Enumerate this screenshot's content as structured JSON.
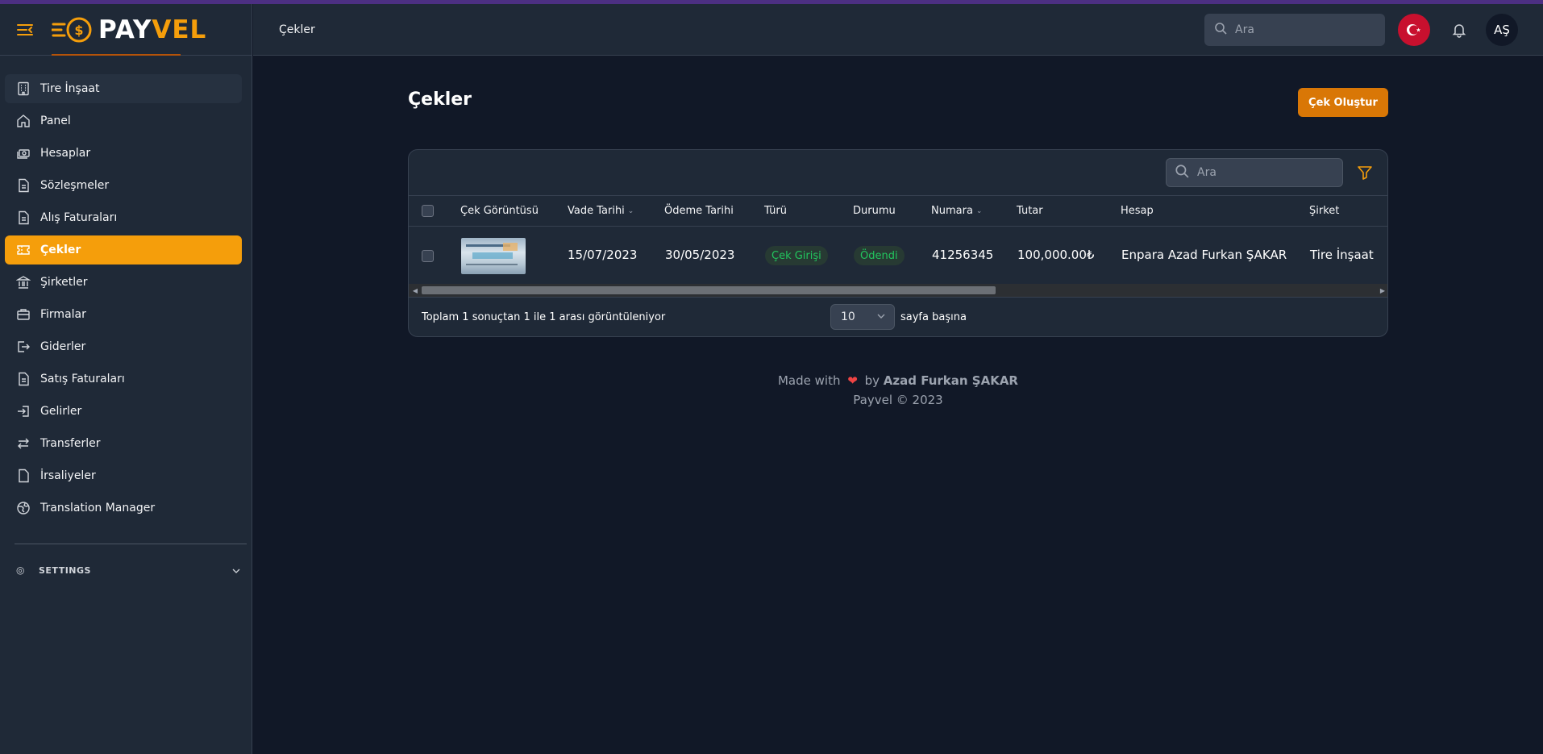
{
  "brand": {
    "name_part1": "PAY",
    "name_part2": "VEL"
  },
  "colors": {
    "accent": "#f59e0b",
    "button": "#d97706",
    "background": "#111827",
    "surface": "#1f2937",
    "success": "#22c55e"
  },
  "sidebar": {
    "items": [
      {
        "label": "Tire İnşaat",
        "icon": "building-icon"
      },
      {
        "label": "Panel",
        "icon": "home-icon"
      },
      {
        "label": "Hesaplar",
        "icon": "cash-icon"
      },
      {
        "label": "Sözleşmeler",
        "icon": "document-icon"
      },
      {
        "label": "Alış Faturaları",
        "icon": "document-icon"
      },
      {
        "label": "Çekler",
        "icon": "ticket-icon",
        "active": true
      },
      {
        "label": "Şirketler",
        "icon": "library-icon"
      },
      {
        "label": "Firmalar",
        "icon": "briefcase-icon"
      },
      {
        "label": "Giderler",
        "icon": "logout-icon"
      },
      {
        "label": "Satış Faturaları",
        "icon": "document-icon"
      },
      {
        "label": "Gelirler",
        "icon": "login-icon"
      },
      {
        "label": "Transferler",
        "icon": "switch-icon"
      },
      {
        "label": "İrsaliyeler",
        "icon": "file-icon"
      },
      {
        "label": "Translation Manager",
        "icon": "globe-icon"
      }
    ],
    "settings_label": "SETTINGS"
  },
  "topbar": {
    "breadcrumb": "Çekler",
    "search_placeholder": "Ara",
    "avatar_initials": "AŞ"
  },
  "page": {
    "title": "Çekler",
    "create_button": "Çek Oluştur"
  },
  "table": {
    "search_placeholder": "Ara",
    "columns": [
      "Çek Görüntüsü",
      "Vade Tarihi",
      "Ödeme Tarihi",
      "Türü",
      "Durumu",
      "Numara",
      "Tutar",
      "Hesap",
      "Şirket"
    ],
    "rows": [
      {
        "vade_tarihi": "15/07/2023",
        "odeme_tarihi": "30/05/2023",
        "turu": "Çek Girişi",
        "durumu": "Ödendi",
        "numara": "41256345",
        "tutar": "100,000.00₺",
        "hesap": "Enpara Azad Furkan ŞAKAR",
        "sirket": "Tire İnşaat"
      }
    ],
    "summary": "Toplam 1 sonuçtan 1 ile 1 arası görüntüleniyor",
    "per_page_value": "10",
    "per_page_label": "sayfa başına"
  },
  "footer": {
    "made_with": "Made with",
    "by": "by",
    "author": "Azad Furkan ŞAKAR",
    "copyright": "Payvel © 2023"
  }
}
